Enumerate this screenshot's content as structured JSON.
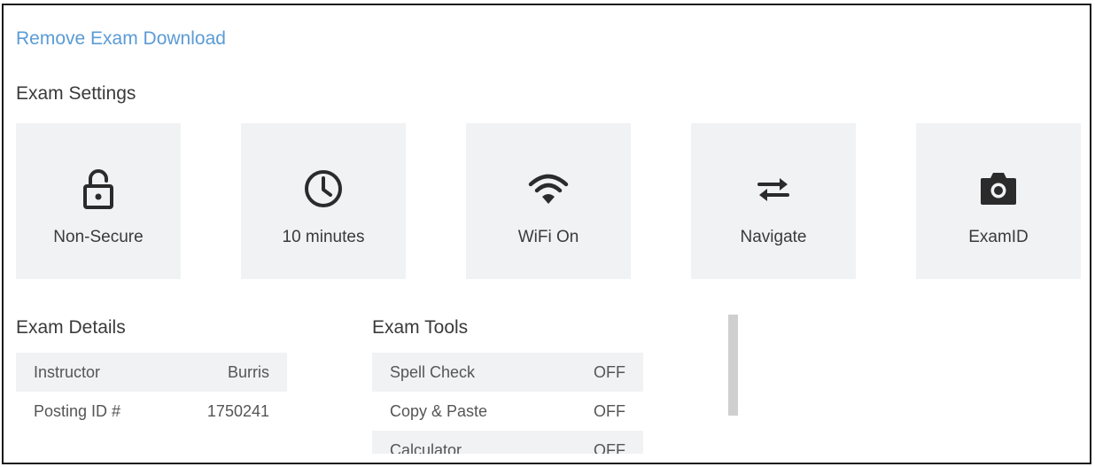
{
  "remove_link": "Remove Exam Download",
  "settings": {
    "title": "Exam Settings",
    "tiles": [
      {
        "label": "Non-Secure",
        "icon": "unlocked-padlock-icon"
      },
      {
        "label": "10 minutes",
        "icon": "clock-icon"
      },
      {
        "label": "WiFi On",
        "icon": "wifi-icon"
      },
      {
        "label": "Navigate",
        "icon": "swap-arrows-icon"
      },
      {
        "label": "ExamID",
        "icon": "camera-icon"
      }
    ]
  },
  "details": {
    "title": "Exam Details",
    "rows": [
      {
        "label": "Instructor",
        "value": "Burris"
      },
      {
        "label": "Posting ID #",
        "value": "1750241"
      }
    ]
  },
  "tools": {
    "title": "Exam Tools",
    "rows": [
      {
        "label": "Spell Check",
        "value": "OFF"
      },
      {
        "label": "Copy & Paste",
        "value": "OFF"
      },
      {
        "label": "Calculator",
        "value": "OFF"
      }
    ]
  },
  "colors": {
    "link": "#5b9bd5",
    "tile_bg": "#f1f2f4",
    "icon": "#2b2b2b",
    "border": "#1a1a1a"
  }
}
